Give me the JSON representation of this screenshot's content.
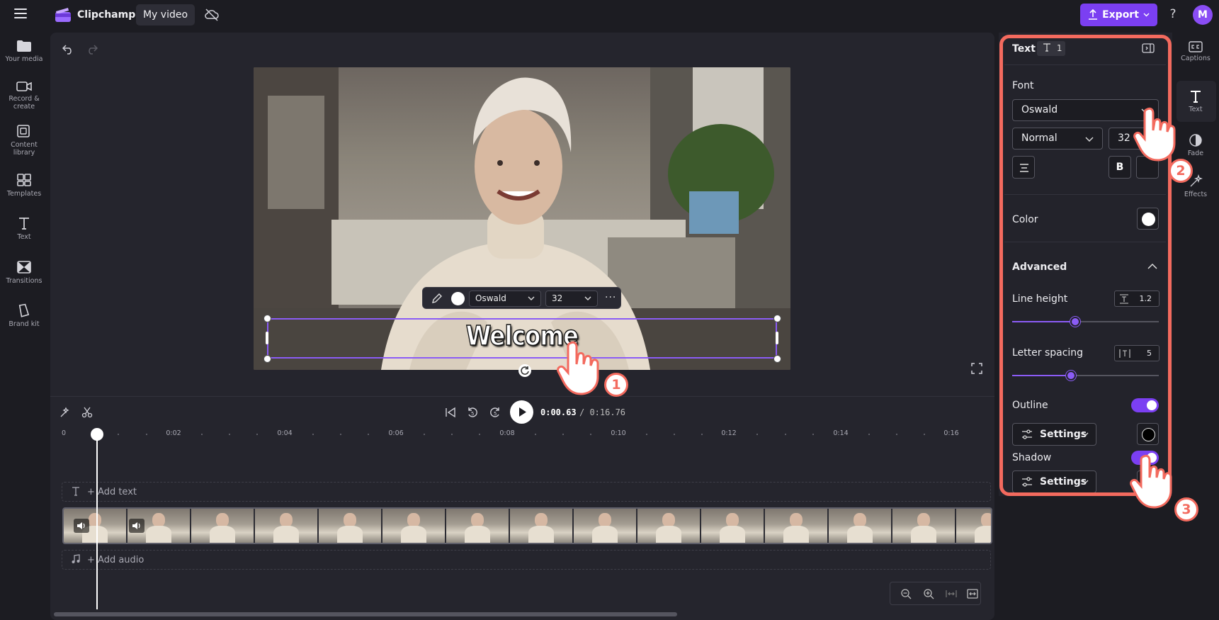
{
  "topbar": {
    "app_name": "Clipchamp",
    "project_name": "My video",
    "export_label": "Export",
    "help_label": "?",
    "avatar_initial": "M"
  },
  "left_nav": [
    {
      "label": "Your media",
      "icon": "folder-icon"
    },
    {
      "label": "Record & create",
      "icon": "camera-icon"
    },
    {
      "label": "Content library",
      "icon": "library-icon"
    },
    {
      "label": "Templates",
      "icon": "templates-icon"
    },
    {
      "label": "Text",
      "icon": "text-icon"
    },
    {
      "label": "Transitions",
      "icon": "transitions-icon"
    },
    {
      "label": "Brand kit",
      "icon": "brand-kit-icon"
    }
  ],
  "preview": {
    "caption_text": "Welcome",
    "toolbar": {
      "font": "Oswald",
      "size": "32",
      "more": "···"
    }
  },
  "playback": {
    "current_time": "0:00.63",
    "total_time": "/ 0:16.76"
  },
  "ruler": {
    "labels": [
      "0",
      "0:02",
      "0:04",
      "0:06",
      "0:08",
      "0:10",
      "0:12",
      "0:14",
      "0:16"
    ]
  },
  "tracks": {
    "text_track_label": "+ Add text",
    "audio_track_label": "+ Add audio"
  },
  "properties": {
    "title": "Text",
    "layer_count": "1",
    "font_label": "Font",
    "font_value": "Oswald",
    "style_value": "Normal",
    "size_value": "32",
    "bold_label": "B",
    "color_label": "Color",
    "advanced_label": "Advanced",
    "line_height_label": "Line height",
    "line_height_value": "1.2",
    "line_height_level": 0.43,
    "letter_spacing_label": "Letter spacing",
    "letter_spacing_value": "5",
    "letter_spacing_level": 0.4,
    "outline_label": "Outline",
    "outline_on": true,
    "outline_settings_label": "Settings",
    "shadow_label": "Shadow",
    "shadow_on": true,
    "shadow_settings_label": "Settings"
  },
  "right_toolbar": [
    {
      "label": "Captions",
      "icon": "captions-icon"
    },
    {
      "label": "Text",
      "icon": "text-icon"
    },
    {
      "label": "Fade",
      "icon": "fade-icon"
    },
    {
      "label": "Effects",
      "icon": "effects-icon"
    }
  ],
  "callouts": [
    "1",
    "2",
    "3"
  ],
  "colors": {
    "accent": "#7b3ff2",
    "highlight": "#f36a5e",
    "text_color": "#ffffff",
    "outline_color": "#000000"
  }
}
